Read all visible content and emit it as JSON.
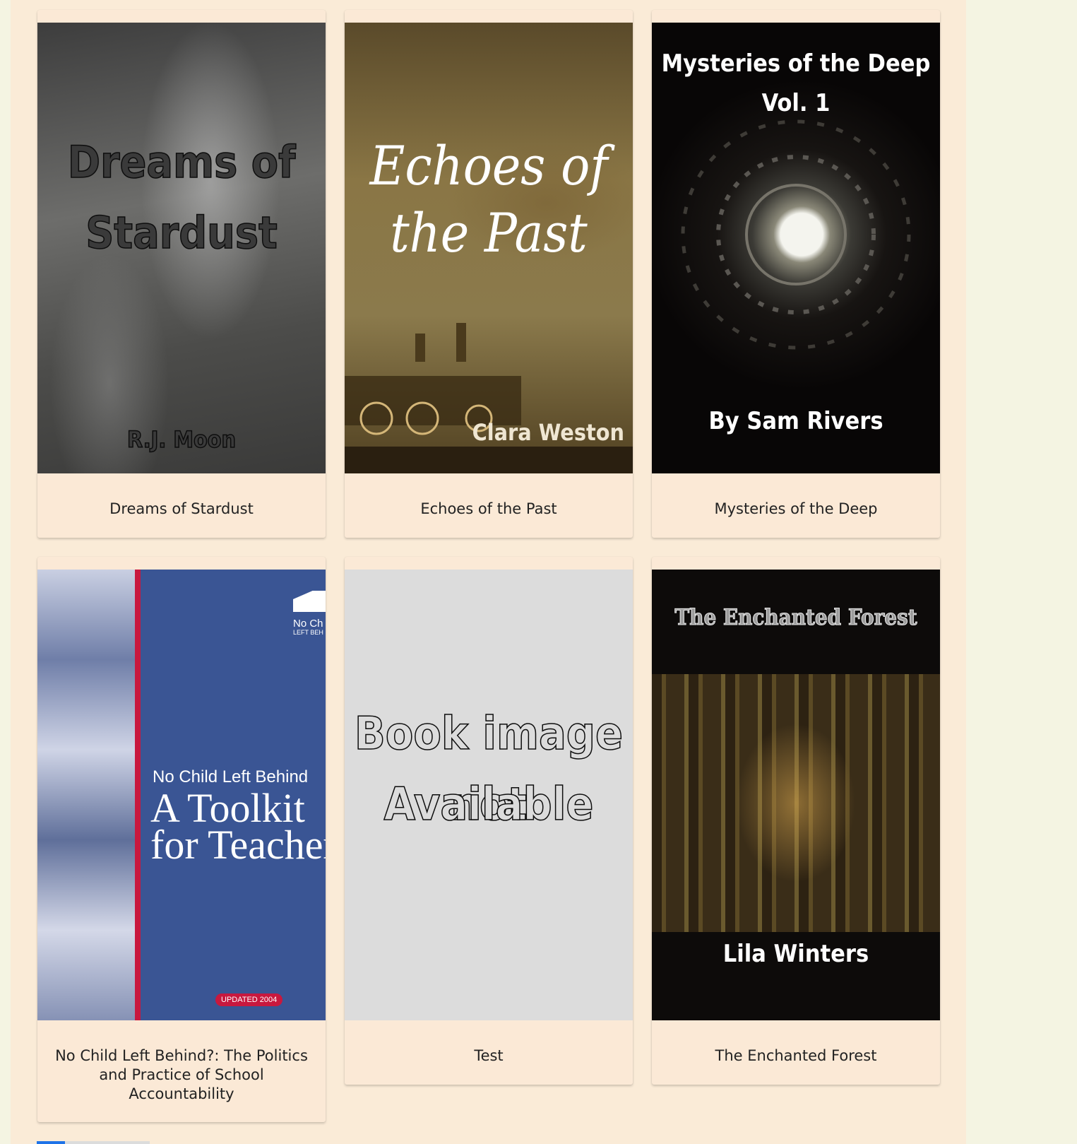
{
  "books": [
    {
      "title": "Dreams of Stardust",
      "cover": {
        "line1": "Dreams of",
        "line2": "Stardust",
        "author": "R.J. Moon"
      }
    },
    {
      "title": "Echoes of the Past",
      "cover": {
        "line1": "Echoes of",
        "line2": "the Past",
        "author": "Clara Weston"
      }
    },
    {
      "title": "Mysteries of the Deep",
      "cover": {
        "line1": "Mysteries of the Deep",
        "line2": "Vol. 1",
        "author": "By Sam Rivers"
      }
    },
    {
      "title": "No Child Left Behind?: The Politics and Practice of School Accountability",
      "cover": {
        "badge": "No Ch",
        "badge2": "LEFT BEH",
        "line1": "No Child Left Behind",
        "line2": "A Toolkit",
        "line3": "for Teacher",
        "tag": "UPDATED 2004"
      }
    },
    {
      "title": "Test",
      "cover": {
        "line1": "Book image not",
        "line2": "Available"
      }
    },
    {
      "title": "The Enchanted Forest",
      "cover": {
        "line1": "The Enchanted Forest",
        "author": "Lila Winters"
      }
    }
  ],
  "colors": {
    "page_bg": "#f4f4e2",
    "panel_bg": "#faebd7",
    "card_bg": "#fbe9d6",
    "pager_accent": "#1e73e8"
  }
}
